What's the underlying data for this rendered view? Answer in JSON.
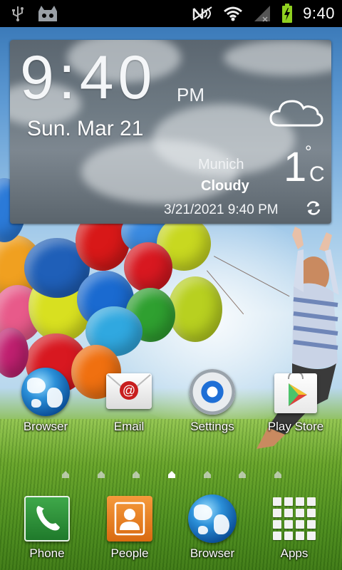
{
  "status_bar": {
    "time": "9:40",
    "left_icons": [
      "usb-icon",
      "cyanogenmod-icon"
    ],
    "right_icons": [
      "nfc-icon",
      "wifi-icon",
      "signal-icon",
      "battery-charging-icon"
    ]
  },
  "clock_widget": {
    "time": "9:40",
    "ampm": "PM",
    "date": "Sun. Mar 21",
    "city": "Munich",
    "condition": "Cloudy",
    "temperature": "1",
    "degree_symbol": "°",
    "unit": "C",
    "updated": "3/21/2021 9:40 PM",
    "weather_icon": "cloud-icon",
    "refresh_icon": "refresh-icon"
  },
  "home_icons": [
    {
      "label": "Browser",
      "icon": "browser-globe-icon"
    },
    {
      "label": "Email",
      "icon": "email-icon"
    },
    {
      "label": "Settings",
      "icon": "settings-icon"
    },
    {
      "label": "Play Store",
      "icon": "play-store-icon"
    }
  ],
  "page_indicator": {
    "count": 7,
    "active_index": 3
  },
  "dock": [
    {
      "label": "Phone",
      "icon": "phone-icon"
    },
    {
      "label": "People",
      "icon": "people-icon"
    },
    {
      "label": "Browser",
      "icon": "browser-globe-icon"
    },
    {
      "label": "Apps",
      "icon": "apps-grid-icon"
    }
  ],
  "colors": {
    "status_bar_bg": "#000000",
    "widget_bg": "#6f7b84",
    "accent_blue": "#1f6fd6"
  }
}
